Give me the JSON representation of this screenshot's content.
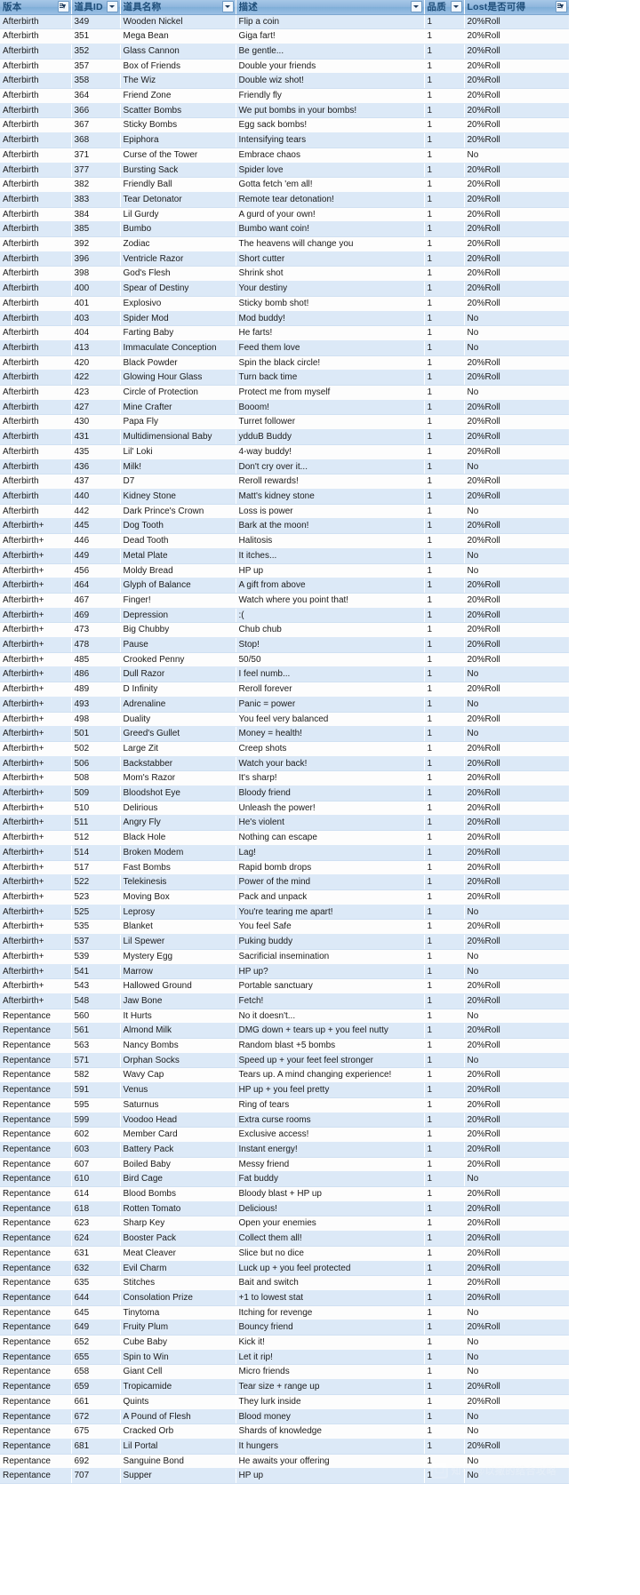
{
  "app": {
    "type": "spreadsheet",
    "theme_accent": "#8fb6dd",
    "band_color": "#dce9f7",
    "header_text_color": "#1f4e79"
  },
  "watermark": {
    "text": "知乎 @以撒的结合攻略",
    "icon": "camera-icon"
  },
  "table": {
    "columns": [
      {
        "key": "version",
        "label": "版本",
        "filter": "sorted"
      },
      {
        "key": "id",
        "label": "道具ID",
        "filter": "plain"
      },
      {
        "key": "name",
        "label": "道具名称",
        "filter": "plain"
      },
      {
        "key": "desc",
        "label": "描述",
        "filter": "plain"
      },
      {
        "key": "quality",
        "label": "品质",
        "filter": "plain"
      },
      {
        "key": "lost",
        "label": "Lost是否可得",
        "filter": "sorted"
      }
    ],
    "rows": [
      [
        "Afterbirth",
        "349",
        "Wooden Nickel",
        "Flip a coin",
        "1",
        "20%Roll"
      ],
      [
        "Afterbirth",
        "351",
        "Mega Bean",
        "Giga fart!",
        "1",
        "20%Roll"
      ],
      [
        "Afterbirth",
        "352",
        "Glass Cannon",
        "Be gentle...",
        "1",
        "20%Roll"
      ],
      [
        "Afterbirth",
        "357",
        "Box of Friends",
        "Double your friends",
        "1",
        "20%Roll"
      ],
      [
        "Afterbirth",
        "358",
        "The Wiz",
        "Double wiz shot!",
        "1",
        "20%Roll"
      ],
      [
        "Afterbirth",
        "364",
        "Friend Zone",
        "Friendly fly",
        "1",
        "20%Roll"
      ],
      [
        "Afterbirth",
        "366",
        "Scatter Bombs",
        "We put bombs in your bombs!",
        "1",
        "20%Roll"
      ],
      [
        "Afterbirth",
        "367",
        "Sticky Bombs",
        "Egg sack bombs!",
        "1",
        "20%Roll"
      ],
      [
        "Afterbirth",
        "368",
        "Epiphora",
        "Intensifying tears",
        "1",
        "20%Roll"
      ],
      [
        "Afterbirth",
        "371",
        "Curse of the Tower",
        "Embrace chaos",
        "1",
        "No"
      ],
      [
        "Afterbirth",
        "377",
        "Bursting Sack",
        "Spider love",
        "1",
        "20%Roll"
      ],
      [
        "Afterbirth",
        "382",
        "Friendly Ball",
        "Gotta fetch 'em all!",
        "1",
        "20%Roll"
      ],
      [
        "Afterbirth",
        "383",
        "Tear Detonator",
        "Remote tear detonation!",
        "1",
        "20%Roll"
      ],
      [
        "Afterbirth",
        "384",
        "Lil Gurdy",
        "A gurd of your own!",
        "1",
        "20%Roll"
      ],
      [
        "Afterbirth",
        "385",
        "Bumbo",
        "Bumbo want coin!",
        "1",
        "20%Roll"
      ],
      [
        "Afterbirth",
        "392",
        "Zodiac",
        "The heavens will change you",
        "1",
        "20%Roll"
      ],
      [
        "Afterbirth",
        "396",
        "Ventricle Razor",
        "Short cutter",
        "1",
        "20%Roll"
      ],
      [
        "Afterbirth",
        "398",
        "God's Flesh",
        "Shrink shot",
        "1",
        "20%Roll"
      ],
      [
        "Afterbirth",
        "400",
        "Spear of Destiny",
        "Your destiny",
        "1",
        "20%Roll"
      ],
      [
        "Afterbirth",
        "401",
        "Explosivo",
        "Sticky bomb shot!",
        "1",
        "20%Roll"
      ],
      [
        "Afterbirth",
        "403",
        "Spider Mod",
        "Mod buddy!",
        "1",
        "No"
      ],
      [
        "Afterbirth",
        "404",
        "Farting Baby",
        "He farts!",
        "1",
        "No"
      ],
      [
        "Afterbirth",
        "413",
        "Immaculate Conception",
        "Feed them love",
        "1",
        "No"
      ],
      [
        "Afterbirth",
        "420",
        "Black Powder",
        "Spin the black circle!",
        "1",
        "20%Roll"
      ],
      [
        "Afterbirth",
        "422",
        "Glowing Hour Glass",
        "Turn back time",
        "1",
        "20%Roll"
      ],
      [
        "Afterbirth",
        "423",
        "Circle of Protection",
        "Protect me from myself",
        "1",
        "No"
      ],
      [
        "Afterbirth",
        "427",
        "Mine Crafter",
        "Booom!",
        "1",
        "20%Roll"
      ],
      [
        "Afterbirth",
        "430",
        "Papa Fly",
        "Turret follower",
        "1",
        "20%Roll"
      ],
      [
        "Afterbirth",
        "431",
        "Multidimensional Baby",
        "ydduB Buddy",
        "1",
        "20%Roll"
      ],
      [
        "Afterbirth",
        "435",
        "Lil' Loki",
        "4-way buddy!",
        "1",
        "20%Roll"
      ],
      [
        "Afterbirth",
        "436",
        "Milk!",
        "Don't cry over it...",
        "1",
        "No"
      ],
      [
        "Afterbirth",
        "437",
        "D7",
        "Reroll rewards!",
        "1",
        "20%Roll"
      ],
      [
        "Afterbirth",
        "440",
        "Kidney Stone",
        "Matt's kidney stone",
        "1",
        "20%Roll"
      ],
      [
        "Afterbirth",
        "442",
        "Dark Prince's Crown",
        "Loss is power",
        "1",
        "No"
      ],
      [
        "Afterbirth+",
        "445",
        "Dog Tooth",
        "Bark at the moon!",
        "1",
        "20%Roll"
      ],
      [
        "Afterbirth+",
        "446",
        "Dead Tooth",
        "Halitosis",
        "1",
        "20%Roll"
      ],
      [
        "Afterbirth+",
        "449",
        "Metal Plate",
        "It itches...",
        "1",
        "No"
      ],
      [
        "Afterbirth+",
        "456",
        "Moldy Bread",
        "HP up",
        "1",
        "No"
      ],
      [
        "Afterbirth+",
        "464",
        "Glyph of Balance",
        "A gift from above",
        "1",
        "20%Roll"
      ],
      [
        "Afterbirth+",
        "467",
        "Finger!",
        "Watch where you point that!",
        "1",
        "20%Roll"
      ],
      [
        "Afterbirth+",
        "469",
        "Depression",
        ":(",
        "1",
        "20%Roll"
      ],
      [
        "Afterbirth+",
        "473",
        "Big Chubby",
        "Chub chub",
        "1",
        "20%Roll"
      ],
      [
        "Afterbirth+",
        "478",
        "Pause",
        "Stop!",
        "1",
        "20%Roll"
      ],
      [
        "Afterbirth+",
        "485",
        "Crooked Penny",
        "50/50",
        "1",
        "20%Roll"
      ],
      [
        "Afterbirth+",
        "486",
        "Dull Razor",
        "I feel numb...",
        "1",
        "No"
      ],
      [
        "Afterbirth+",
        "489",
        "D Infinity",
        "Reroll forever",
        "1",
        "20%Roll"
      ],
      [
        "Afterbirth+",
        "493",
        "Adrenaline",
        "Panic = power",
        "1",
        "No"
      ],
      [
        "Afterbirth+",
        "498",
        "Duality",
        "You feel very balanced",
        "1",
        "20%Roll"
      ],
      [
        "Afterbirth+",
        "501",
        "Greed's Gullet",
        "Money = health!",
        "1",
        "No"
      ],
      [
        "Afterbirth+",
        "502",
        "Large Zit",
        "Creep shots",
        "1",
        "20%Roll"
      ],
      [
        "Afterbirth+",
        "506",
        "Backstabber",
        "Watch your back!",
        "1",
        "20%Roll"
      ],
      [
        "Afterbirth+",
        "508",
        "Mom's Razor",
        "It's sharp!",
        "1",
        "20%Roll"
      ],
      [
        "Afterbirth+",
        "509",
        "Bloodshot Eye",
        "Bloody friend",
        "1",
        "20%Roll"
      ],
      [
        "Afterbirth+",
        "510",
        "Delirious",
        "Unleash the power!",
        "1",
        "20%Roll"
      ],
      [
        "Afterbirth+",
        "511",
        "Angry Fly",
        "He's violent",
        "1",
        "20%Roll"
      ],
      [
        "Afterbirth+",
        "512",
        "Black Hole",
        "Nothing can escape",
        "1",
        "20%Roll"
      ],
      [
        "Afterbirth+",
        "514",
        "Broken Modem",
        "Lag!",
        "1",
        "20%Roll"
      ],
      [
        "Afterbirth+",
        "517",
        "Fast Bombs",
        "Rapid bomb drops",
        "1",
        "20%Roll"
      ],
      [
        "Afterbirth+",
        "522",
        "Telekinesis",
        "Power of the mind",
        "1",
        "20%Roll"
      ],
      [
        "Afterbirth+",
        "523",
        "Moving Box",
        "Pack and unpack",
        "1",
        "20%Roll"
      ],
      [
        "Afterbirth+",
        "525",
        "Leprosy",
        "You're tearing me apart!",
        "1",
        "No"
      ],
      [
        "Afterbirth+",
        "535",
        "Blanket",
        "You feel Safe",
        "1",
        "20%Roll"
      ],
      [
        "Afterbirth+",
        "537",
        "Lil Spewer",
        "Puking buddy",
        "1",
        "20%Roll"
      ],
      [
        "Afterbirth+",
        "539",
        "Mystery Egg",
        "Sacrificial insemination",
        "1",
        "No"
      ],
      [
        "Afterbirth+",
        "541",
        "Marrow",
        "HP up?",
        "1",
        "No"
      ],
      [
        "Afterbirth+",
        "543",
        "Hallowed Ground",
        "Portable sanctuary",
        "1",
        "20%Roll"
      ],
      [
        "Afterbirth+",
        "548",
        "Jaw Bone",
        "Fetch!",
        "1",
        "20%Roll"
      ],
      [
        "Repentance",
        "560",
        "It Hurts",
        "No it doesn't...",
        "1",
        "No"
      ],
      [
        "Repentance",
        "561",
        "Almond Milk",
        "DMG down + tears up + you feel nutty",
        "1",
        "20%Roll"
      ],
      [
        "Repentance",
        "563",
        "Nancy Bombs",
        "Random blast +5 bombs",
        "1",
        "20%Roll"
      ],
      [
        "Repentance",
        "571",
        "Orphan Socks",
        "Speed up + your feet feel stronger",
        "1",
        "No"
      ],
      [
        "Repentance",
        "582",
        "Wavy Cap",
        "Tears up. A mind changing experience!",
        "1",
        "20%Roll"
      ],
      [
        "Repentance",
        "591",
        "Venus",
        "HP up + you feel pretty",
        "1",
        "20%Roll"
      ],
      [
        "Repentance",
        "595",
        "Saturnus",
        "Ring of tears",
        "1",
        "20%Roll"
      ],
      [
        "Repentance",
        "599",
        "Voodoo Head",
        "Extra curse rooms",
        "1",
        "20%Roll"
      ],
      [
        "Repentance",
        "602",
        "Member Card",
        "Exclusive access!",
        "1",
        "20%Roll"
      ],
      [
        "Repentance",
        "603",
        "Battery Pack",
        "Instant energy!",
        "1",
        "20%Roll"
      ],
      [
        "Repentance",
        "607",
        "Boiled Baby",
        "Messy friend",
        "1",
        "20%Roll"
      ],
      [
        "Repentance",
        "610",
        "Bird Cage",
        "Fat buddy",
        "1",
        "No"
      ],
      [
        "Repentance",
        "614",
        "Blood Bombs",
        "Bloody blast + HP up",
        "1",
        "20%Roll"
      ],
      [
        "Repentance",
        "618",
        "Rotten Tomato",
        "Delicious!",
        "1",
        "20%Roll"
      ],
      [
        "Repentance",
        "623",
        "Sharp Key",
        "Open your enemies",
        "1",
        "20%Roll"
      ],
      [
        "Repentance",
        "624",
        "Booster Pack",
        "Collect them all!",
        "1",
        "20%Roll"
      ],
      [
        "Repentance",
        "631",
        "Meat Cleaver",
        "Slice but no dice",
        "1",
        "20%Roll"
      ],
      [
        "Repentance",
        "632",
        "Evil Charm",
        "Luck up + you feel protected",
        "1",
        "20%Roll"
      ],
      [
        "Repentance",
        "635",
        "Stitches",
        "Bait and switch",
        "1",
        "20%Roll"
      ],
      [
        "Repentance",
        "644",
        "Consolation Prize",
        "+1 to lowest stat",
        "1",
        "20%Roll"
      ],
      [
        "Repentance",
        "645",
        "Tinytoma",
        "Itching for revenge",
        "1",
        "No"
      ],
      [
        "Repentance",
        "649",
        "Fruity Plum",
        "Bouncy friend",
        "1",
        "20%Roll"
      ],
      [
        "Repentance",
        "652",
        "Cube Baby",
        "Kick it!",
        "1",
        "No"
      ],
      [
        "Repentance",
        "655",
        "Spin to Win",
        "Let it rip!",
        "1",
        "No"
      ],
      [
        "Repentance",
        "658",
        "Giant Cell",
        "Micro friends",
        "1",
        "No"
      ],
      [
        "Repentance",
        "659",
        "Tropicamide",
        "Tear size + range up",
        "1",
        "20%Roll"
      ],
      [
        "Repentance",
        "661",
        "Quints",
        "They lurk inside",
        "1",
        "20%Roll"
      ],
      [
        "Repentance",
        "672",
        "A Pound of Flesh",
        "Blood money",
        "1",
        "No"
      ],
      [
        "Repentance",
        "675",
        "Cracked Orb",
        "Shards of knowledge",
        "1",
        "No"
      ],
      [
        "Repentance",
        "681",
        "Lil Portal",
        "It hungers",
        "1",
        "20%Roll"
      ],
      [
        "Repentance",
        "692",
        "Sanguine Bond",
        "He awaits your offering",
        "1",
        "No"
      ],
      [
        "Repentance",
        "707",
        "Supper",
        "HP up",
        "1",
        "No"
      ]
    ]
  }
}
